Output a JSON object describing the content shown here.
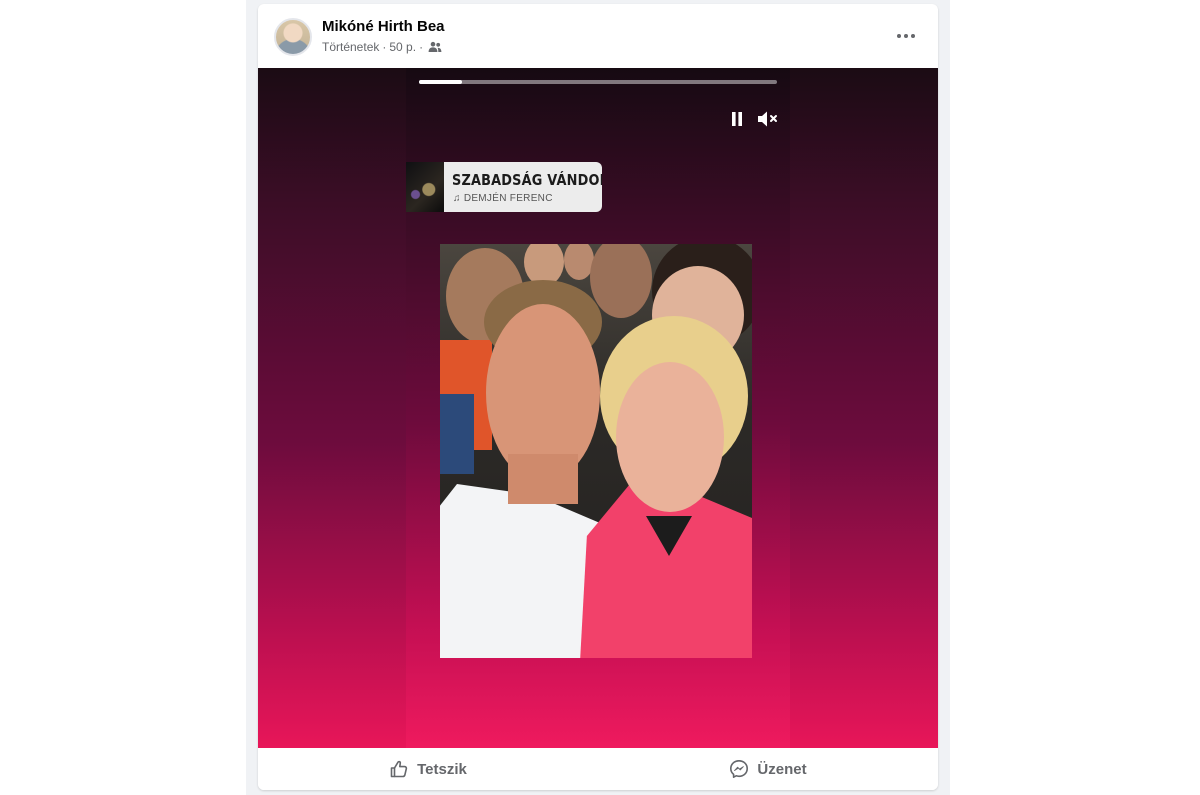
{
  "post": {
    "author_name": "Mikóné Hirth Bea",
    "source": "Történetek",
    "time": "50 p.",
    "separator": "·",
    "audience_icon": "friends-icon",
    "more_icon": "more-horizontal-icon"
  },
  "story": {
    "progress": 0.12,
    "controls": [
      "pause-icon",
      "mute-icon"
    ],
    "music": {
      "title": "SZABADSÁG VÁNDORAI",
      "artist": "DEMJÉN FERENC",
      "icon": "music-note-icon"
    },
    "photo_description_icon": "photo"
  },
  "actions": [
    {
      "label": "Tetszik",
      "icon": "like-icon"
    },
    {
      "label": "Üzenet",
      "icon": "messenger-icon"
    }
  ],
  "colors": {
    "story_top": "#1b0c14",
    "story_bottom": "#e81659",
    "text_secondary": "#65676b"
  }
}
